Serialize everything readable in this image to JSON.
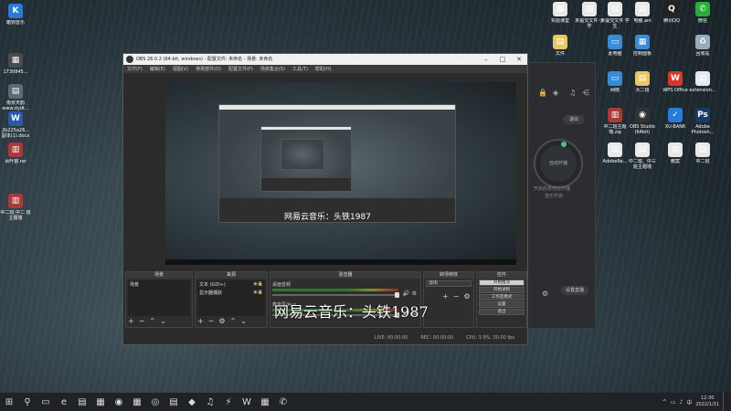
{
  "desktop": {
    "left_icons": [
      {
        "label": "酷狗音乐",
        "glyph": "K",
        "color": "#2a7ad6"
      },
      {
        "label": "1730845...",
        "glyph": "▦",
        "color": "#4a4a4a"
      },
      {
        "label": "南京天韵 www.dydt...",
        "glyph": "▤",
        "color": "#5a6a7a"
      },
      {
        "label": "2b225a26... 副本(1).docx",
        "glyph": "W",
        "color": "#2b5aa8"
      },
      {
        "label": "百叶窗.rar",
        "glyph": "▥",
        "color": "#a83a3a"
      },
      {
        "label": "中二班 中二 班主题墙",
        "glyph": "▥",
        "color": "#a83a3a"
      }
    ],
    "right_icons": [
      {
        "label": "实验课堂",
        "glyph": "▦",
        "color": "#e8e8e8"
      },
      {
        "label": "未提交文件 小学",
        "glyph": "▤",
        "color": "#e8e8e8"
      },
      {
        "label": "未提交文件 学生",
        "glyph": "▤",
        "color": "#e8e8e8"
      },
      {
        "label": "电脑.ani",
        "glyph": "▤",
        "color": "#e8e8e8"
      },
      {
        "label": "腾讯QQ",
        "glyph": "Q",
        "color": "#222"
      },
      {
        "label": "微信",
        "glyph": "✆",
        "color": "#2aae3a"
      },
      {
        "label": "文件",
        "glyph": "▤",
        "color": "#e8c860"
      },
      {
        "label": "此电脑",
        "glyph": "▭",
        "color": "#3a8ad6"
      },
      {
        "label": "控制面板",
        "glyph": "▦",
        "color": "#3a8ad6"
      },
      {
        "label": "回收站",
        "glyph": "♻",
        "color": "#9ab"
      },
      {
        "label": "网络",
        "glyph": "▭",
        "color": "#3a8ad6"
      },
      {
        "label": "大二班",
        "glyph": "▤",
        "color": "#e8c860"
      },
      {
        "label": "WPS Office",
        "glyph": "W",
        "color": "#d23a2a"
      },
      {
        "label": "extension...",
        "glyph": "▤",
        "color": "#e8e8e8"
      },
      {
        "label": "中二班主题墙.zip",
        "glyph": "▥",
        "color": "#a83a3a"
      },
      {
        "label": "OBS Studio (64bit)",
        "glyph": "◉",
        "color": "#333"
      },
      {
        "label": "XU-BANK",
        "glyph": "✓",
        "color": "#2a7ad6"
      },
      {
        "label": "Adobe Photosh...",
        "glyph": "Ps",
        "color": "#1a3a6a"
      },
      {
        "label": "AdobeRe...",
        "glyph": "▤",
        "color": "#e8e8e8"
      },
      {
        "label": "中二班、中三 班主题墙",
        "glyph": "▤",
        "color": "#e8e8e8"
      },
      {
        "label": "教案",
        "glyph": "▤",
        "color": "#e8e8e8"
      },
      {
        "label": "中二班",
        "glyph": "▤",
        "color": "#e8e8e8"
      },
      {
        "label": "中二资料",
        "glyph": "▤",
        "color": "#e8e8e8"
      },
      {
        "label": "国赛课件",
        "glyph": "▤",
        "color": "#e8e8e8"
      }
    ]
  },
  "music_app": {
    "login_label": "退出",
    "circle_label": "自动开播",
    "line1": "开启后将自动开播",
    "line2": "音乐开启",
    "side_button": "设置直播"
  },
  "obs": {
    "title": "OBS 26.0.2 (64-bit, windows) - 配置文件: 未命名 - 场景: 未命名",
    "menu": [
      "文件(F)",
      "编辑(E)",
      "视图(V)",
      "停靠部件(D)",
      "配置文件(P)",
      "场景集合(S)",
      "工具(T)",
      "帮助(H)"
    ],
    "preview_lyric": "网易云音乐：头铁1987",
    "docks": {
      "scenes_title": "场景",
      "scenes": [
        "场景"
      ],
      "sources_title": "来源",
      "sources": [
        "文本 (GDI+)",
        "显示器捕获"
      ],
      "mixer_title": "混音器",
      "mixer": [
        {
          "name": "桌面音频",
          "db": "0.0 dB"
        },
        {
          "name": "麦克风/Aux",
          "db": "0.0 dB"
        }
      ],
      "transitions_title": "转场特效",
      "transition_value": "淡出",
      "controls_title": "控件",
      "controls": [
        "开始推流",
        "开始录制",
        "工作室模式",
        "设置",
        "退出"
      ]
    },
    "status": {
      "live": "LIVE: 00:00:00",
      "rec": "REC: 00:00:00",
      "cpu": "CPU: 3.9%, 30.00 fps"
    }
  },
  "overlay_lyric": "网易云音乐：头铁1987",
  "taskbar": {
    "items": [
      "⊞",
      "⚲",
      "▭",
      "e",
      "▤",
      "▦",
      "◉",
      "▦",
      "◎",
      "▤",
      "◆",
      "♫",
      "⚡",
      "W",
      "▦",
      "✆"
    ],
    "tray": [
      "^",
      "▭",
      "♪",
      "中"
    ],
    "time": "12:30",
    "date": "2022/1/31"
  }
}
